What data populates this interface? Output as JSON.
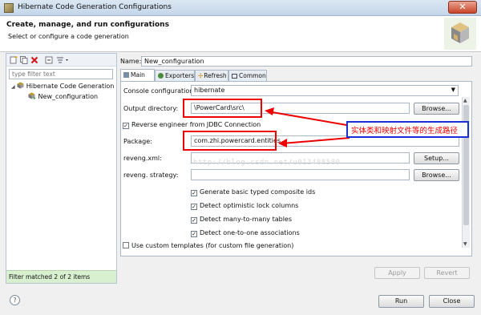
{
  "window": {
    "title": "Hibernate Code Generation Configurations",
    "close_glyph": "✕"
  },
  "banner": {
    "title": "Create, manage, and run configurations",
    "subtitle": "Select or configure a code generation"
  },
  "left": {
    "filter_placeholder": "type filter text",
    "tree": {
      "root": "Hibernate Code Generation",
      "child": "New_configuration"
    },
    "status": "Filter matched 2 of 2 items"
  },
  "name": {
    "label": "Name:",
    "value": "New_configuration"
  },
  "tabs": [
    "Main",
    "Exporters",
    "Refresh",
    "Common"
  ],
  "form": {
    "console_label": "Console configuration:",
    "console_value": "hibernate",
    "output_label": "Output directory:",
    "output_value": "\\PowerCard\\src\\",
    "browse": "Browse...",
    "reverse_label": "Reverse engineer from JDBC Connection",
    "package_label": "Package:",
    "package_value": "com.zhi.powercard.entities",
    "revengxml_label": "reveng.xml:",
    "setup": "Setup...",
    "revengstrategy_label": "reveng. strategy:",
    "checks": [
      "Generate basic typed composite ids",
      "Detect optimistic lock columns",
      "Detect many-to-many tables",
      "Detect one-to-one associations"
    ],
    "custom_templates": "Use custom templates (for custom file generation)",
    "apply": "Apply",
    "revert": "Revert"
  },
  "annotation": "实体类和映射文件等的生成路径",
  "watermark": "http://blog.csdn.net/u013488580",
  "footer": {
    "run": "Run",
    "close": "Close",
    "help": "?"
  },
  "colors": {
    "annotation_red": "#e00000",
    "annotation_blue": "#1a2fd6",
    "status_green": "#d8efd0"
  },
  "icons": [
    "hibernate-logo-icon",
    "new-config-icon",
    "duplicate-icon",
    "delete-icon",
    "collapse-icon",
    "filter-icon",
    "help-icon",
    "checked-icon"
  ]
}
